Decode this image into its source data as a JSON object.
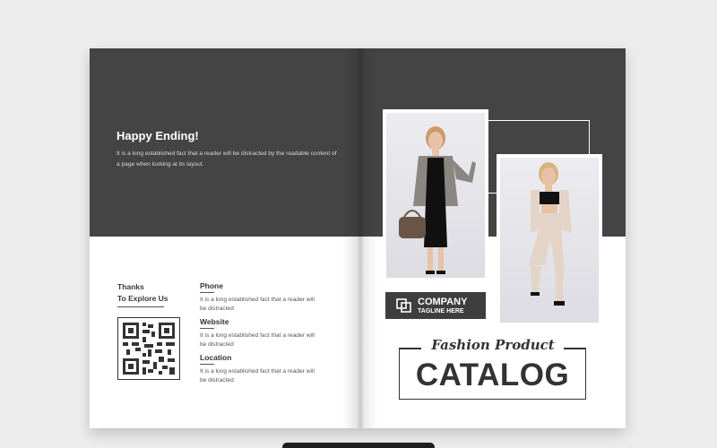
{
  "left_page": {
    "heading": "Happy Ending!",
    "intro": "It is a long established fact that a reader will be distracted by the readable content of a page when looking at its layout.",
    "thanks_line1": "Thanks",
    "thanks_line2": "To Explore Us",
    "contacts": [
      {
        "label": "Phone",
        "text": "It is a long established fact that a reader will be distracted"
      },
      {
        "label": "Website",
        "text": "It is a long established fact that a reader will be distracted"
      },
      {
        "label": "Location",
        "text": "It is a long established fact that a reader will be distracted"
      }
    ],
    "qr_icon": "qr-code-icon"
  },
  "right_page": {
    "company": "COMPANY",
    "tagline": "TAGLINE HERE",
    "script_title": "Fashion Product",
    "main_title": "CATALOG"
  },
  "colors": {
    "dark_band": "#444444",
    "text_dark": "#333333",
    "background": "#ececec"
  }
}
